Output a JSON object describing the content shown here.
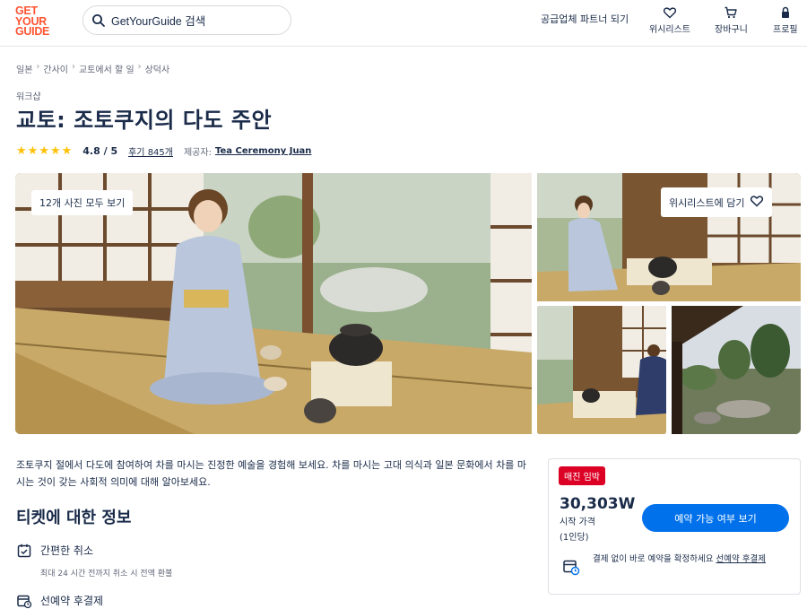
{
  "header": {
    "logo": [
      "GET",
      "YOUR",
      "GUIDE"
    ],
    "search_placeholder": "GetYourGuide 검색",
    "partner": "공급업체 파트너 되기",
    "nav": [
      {
        "label": "위시리스트",
        "icon": "heart-icon"
      },
      {
        "label": "장바구니",
        "icon": "cart-icon"
      },
      {
        "label": "프로필",
        "icon": "user-icon"
      }
    ]
  },
  "breadcrumb": [
    "일본",
    "간사이",
    "교토에서 할 일",
    "상덕사"
  ],
  "category": "워크샵",
  "title": "교토: 조토쿠지의 다도 주안",
  "rating": {
    "stars": 5,
    "value": "4.8 / 5",
    "reviews": "후기 845개",
    "provider_label": "제공자:",
    "provider": "Tea Ceremony Juan"
  },
  "gallery": {
    "all_photos": "12개 사진 모두 보기",
    "wishlist": "위시리스트에 담기"
  },
  "description": "조토쿠지 절에서 다도에 참여하여 차를 마시는 진정한 예술을 경험해 보세요. 차를 마시는 고대 의식과 일본 문화에서 차를 마시는 것이 갖는 사회적 의미에 대해 알아보세요.",
  "ticket_info": {
    "title": "티켓에 대한 정보",
    "features": [
      {
        "label": "간편한 취소",
        "sub": "최대 24 시간 전까지 취소 시 전액 환불"
      },
      {
        "label": "선예약 후결제"
      }
    ]
  },
  "booking": {
    "badge": "매진 임박",
    "price": "30,303W",
    "price_label": "시작 가격",
    "price_unit": "(1인당)",
    "button": "예약 가능 여부 보기",
    "note_text": "결제 없이 바로 예약을 확정하세요",
    "note_link": "선예약 후결제"
  },
  "colors": {
    "brand": "#ff5533",
    "primary": "#0071eb",
    "badge": "#dc0025",
    "star": "#ffc107",
    "text": "#1a2b49"
  }
}
